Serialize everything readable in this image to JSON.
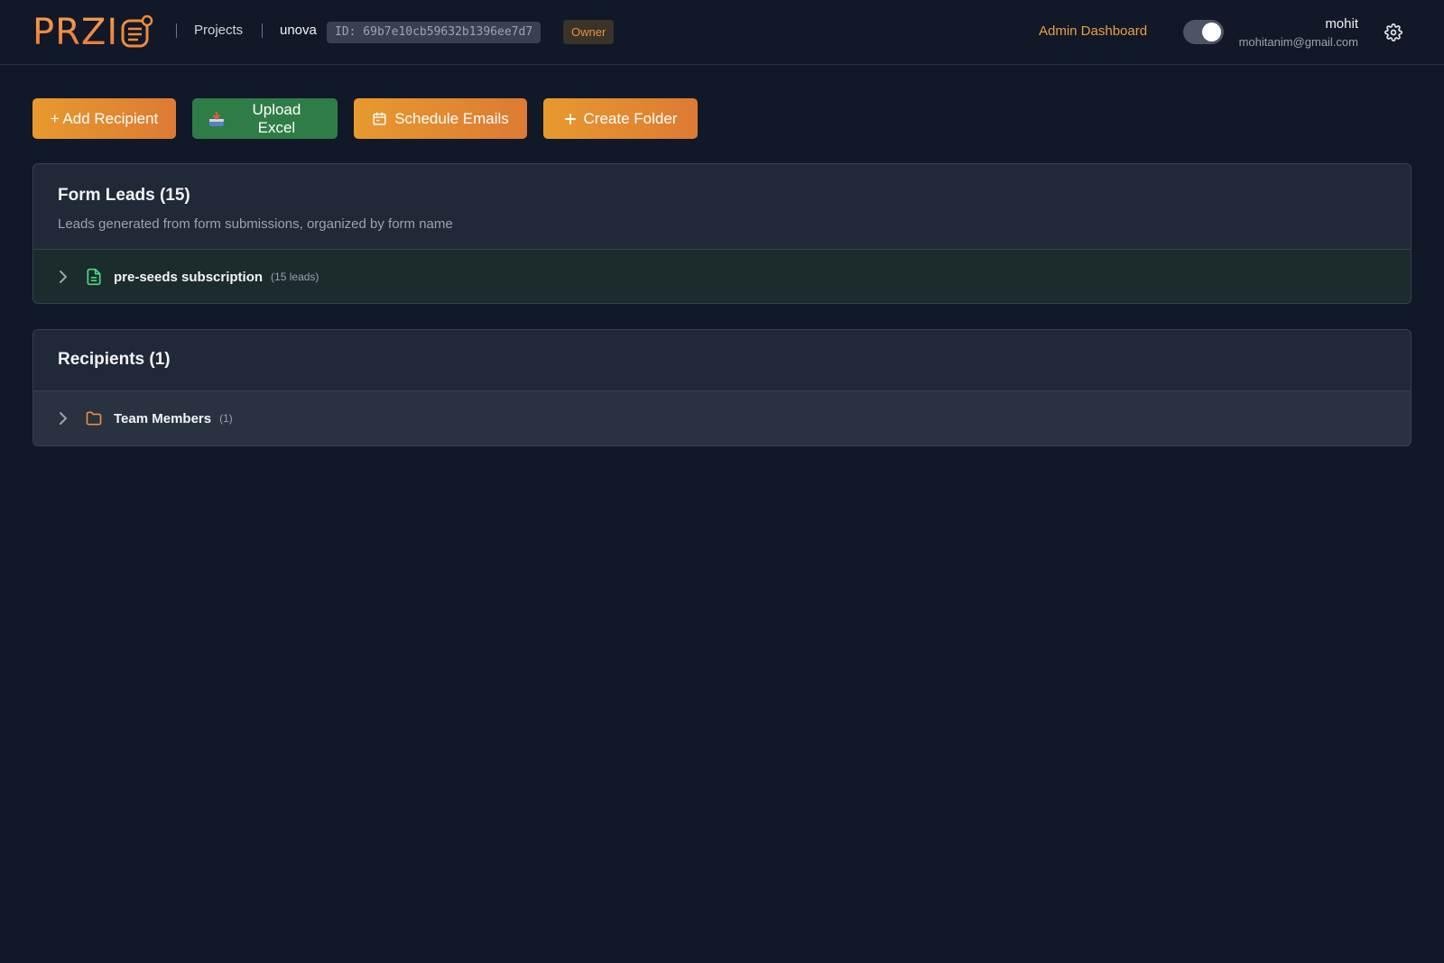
{
  "header": {
    "logo_text": "PRZI",
    "nav_projects": "Projects",
    "project_name": "unova",
    "project_id": "ID: 69b7e10cb59632b1396ee7d7",
    "role_badge": "Owner",
    "admin_link": "Admin Dashboard",
    "user_name": "mohit",
    "user_email": "mohitanim@gmail.com",
    "theme_toggle_on": true
  },
  "actions": {
    "add_recipient": "+ Add Recipient",
    "upload_excel": "Upload Excel",
    "schedule_emails": "Schedule Emails",
    "create_folder": "Create Folder"
  },
  "form_leads": {
    "title": "Form Leads (15)",
    "subtitle": "Leads generated from form submissions, organized by form name",
    "items": [
      {
        "name": "pre-seeds subscription",
        "count": "(15 leads)"
      }
    ]
  },
  "recipients": {
    "title": "Recipients (1)",
    "items": [
      {
        "name": "Team Members",
        "count": "(1)"
      }
    ]
  },
  "colors": {
    "background": "#111827",
    "card": "#1f2937",
    "accent_orange": "#e8913a",
    "accent_green": "#2f7d46",
    "form_icon": "#4ade80",
    "folder_icon": "#e8913a"
  }
}
